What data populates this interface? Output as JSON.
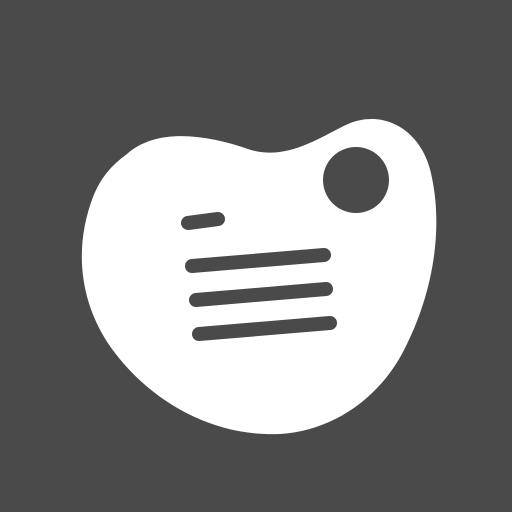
{
  "icon": {
    "name": "note-blob-app-icon",
    "background_color": "#4a4a4a",
    "shape_color": "#ffffff",
    "accent_color": "#4a4a4a",
    "elements": {
      "blob": "blob-shape",
      "dot": "circle-dot",
      "short_line": "short-line",
      "long_lines": [
        "text-line-1",
        "text-line-2",
        "text-line-3"
      ]
    }
  }
}
